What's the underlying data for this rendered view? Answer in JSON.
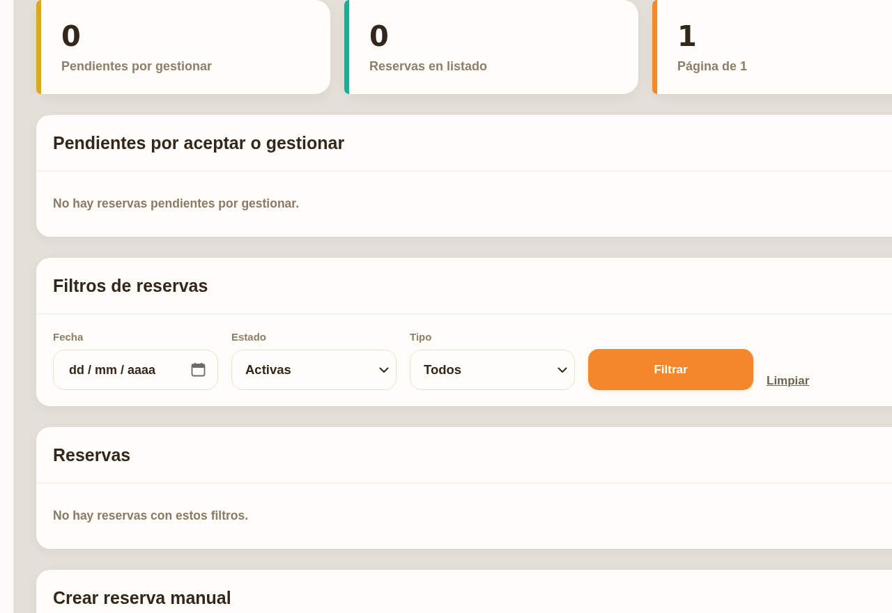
{
  "stats": [
    {
      "value": "0",
      "label": "Pendientes por gestionar",
      "color": "#e0a526"
    },
    {
      "value": "0",
      "label": "Reservas en listado",
      "color": "#2aa59a"
    },
    {
      "value": "1",
      "label": "Página de 1",
      "color": "#f08a2c"
    }
  ],
  "pending_panel": {
    "title": "Pendientes por aceptar o gestionar",
    "empty_message": "No hay reservas pendientes por gestionar."
  },
  "filters_panel": {
    "title": "Filtros de reservas",
    "fields": [
      {
        "kind": "date",
        "label": "Fecha",
        "placeholder": "dd / mm / aaaa"
      },
      {
        "kind": "select",
        "label": "Estado",
        "value": "Activas"
      },
      {
        "kind": "select",
        "label": "Tipo",
        "value": "Todos"
      }
    ],
    "submit": "Filtrar",
    "clear": "Limpiar"
  },
  "reservations_panel": {
    "title": "Reservas",
    "empty_message": "No hay reservas con estos filtros."
  },
  "manual_panel": {
    "title": "Crear reserva manual"
  }
}
